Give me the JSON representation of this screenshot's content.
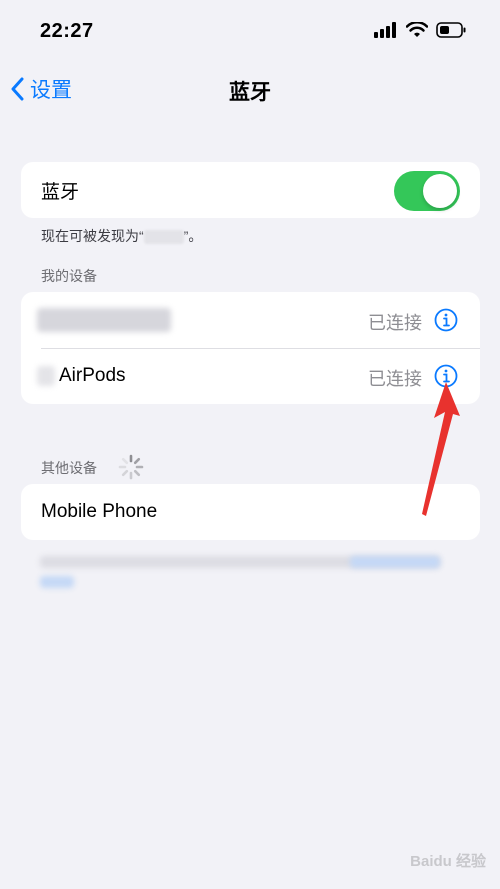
{
  "status_bar": {
    "time": "22:27"
  },
  "nav": {
    "back_label": "设置",
    "title": "蓝牙"
  },
  "bluetooth": {
    "label": "蓝牙",
    "enabled": true,
    "discoverable_prefix": "现在可被发现为“",
    "discoverable_suffix": "”。"
  },
  "my_devices": {
    "header": "我的设备",
    "items": [
      {
        "name": "",
        "status": "已连接"
      },
      {
        "name": "AirPods",
        "status": "已连接"
      }
    ]
  },
  "other_devices": {
    "header": "其他设备",
    "items": [
      {
        "name": "Mobile Phone"
      }
    ]
  },
  "watermark": "Baidu 经验",
  "colors": {
    "accent": "#0a7aff",
    "toggle_on": "#34c759",
    "arrow": "#e8322e"
  }
}
